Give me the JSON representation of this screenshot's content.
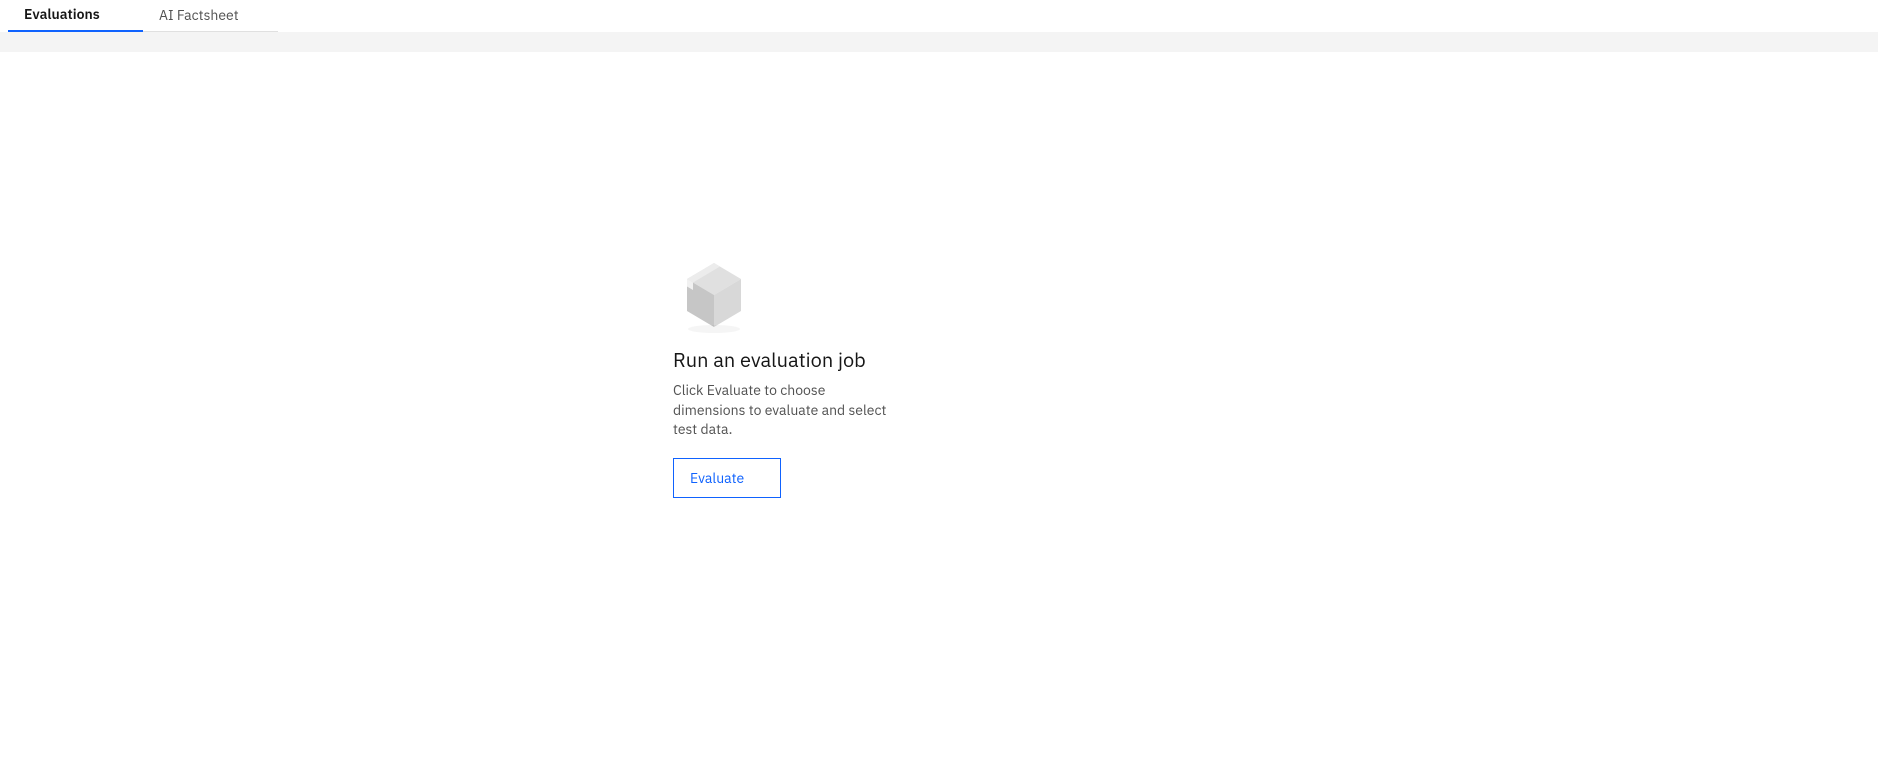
{
  "tabs": {
    "evaluations": "Evaluations",
    "ai_factsheet": "AI Factsheet"
  },
  "empty_state": {
    "heading": "Run an evaluation job",
    "description": "Click Evaluate to choose dimensions to evaluate and select test data.",
    "button_label": "Evaluate"
  },
  "icons": {
    "empty_box": "box-icon"
  }
}
